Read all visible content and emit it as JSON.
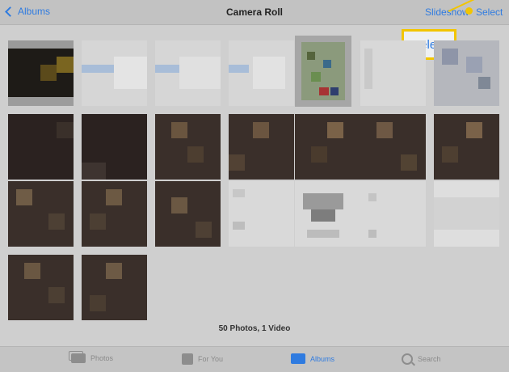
{
  "navbar": {
    "back_label": "Albums",
    "title": "Camera Roll",
    "slideshow_label": "Slideshow",
    "select_label": "Select"
  },
  "callout": {
    "label": "Select"
  },
  "library": {
    "summary": "50 Photos, 1 Video"
  },
  "tabbar": {
    "tabs": [
      {
        "label": "Photos",
        "icon": "photos-icon",
        "active": false
      },
      {
        "label": "For You",
        "icon": "for-you-icon",
        "active": false
      },
      {
        "label": "Albums",
        "icon": "albums-icon",
        "active": true
      },
      {
        "label": "Search",
        "icon": "search-icon",
        "active": false
      }
    ]
  },
  "colors": {
    "accent": "#2f7be0",
    "callout": "#f2c500"
  }
}
